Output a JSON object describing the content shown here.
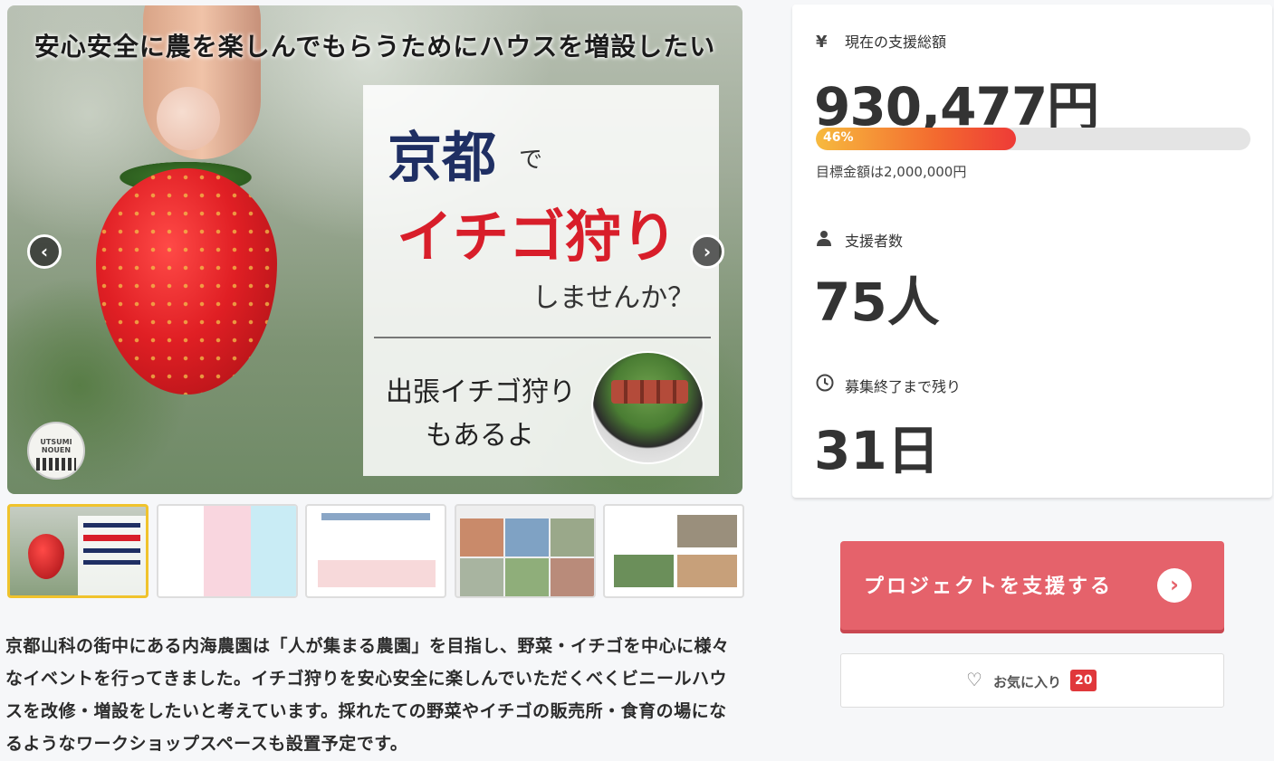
{
  "hero": {
    "top_text": "安心安全に農を楽しんでもらうためにハウスを増設したい",
    "kyoto": "京都",
    "de": "で",
    "ichigo": "イチゴ狩り",
    "shimasenka": "しませんか？",
    "shutcho_line1": "出張イチゴ狩り",
    "shutcho_line2": "もあるよ",
    "logo_text": "UTSUMI NOUEN",
    "prev_arrow": "‹",
    "next_arrow": "›"
  },
  "thumbnails": [
    {
      "name": "thumb-1",
      "active": true
    },
    {
      "name": "thumb-2",
      "active": false
    },
    {
      "name": "thumb-3",
      "active": false
    },
    {
      "name": "thumb-4",
      "active": false
    },
    {
      "name": "thumb-5",
      "active": false
    }
  ],
  "description": {
    "line1": "京都山科の街中にある内海農園は「人が集まる農園」を目指し、野菜・イチゴを中心に様々",
    "line2": "なイベントを行ってきました。イチゴ狩りを安心安全に楽しんでいただくべくビニールハウ",
    "line3": "スを改修・増設をしたいと考えています。採れたての野菜やイチゴの販売所・食育の場にな",
    "line4": "るようなワークショップスペースも設置予定です。"
  },
  "stats": {
    "amount_icon": "¥",
    "amount_label": "現在の支援総額",
    "amount_value": "930,477円",
    "progress_percent": 46,
    "progress_text": "46%",
    "goal_text": "目標金額は2,000,000円",
    "backers_label": "支援者数",
    "backers_value": "75人",
    "remaining_label": "募集終了まで残り",
    "remaining_value": "31日"
  },
  "cta": {
    "label": "プロジェクトを支援する",
    "icon": "›"
  },
  "favorite": {
    "heart": "♡",
    "label": "お気に入り",
    "count": "20"
  },
  "colors": {
    "cta": "#e5626b",
    "progress_start": "#f7ba3e",
    "progress_end": "#ee3b37",
    "badge": "#e0383b",
    "thumb_active": "#f0c32c"
  }
}
